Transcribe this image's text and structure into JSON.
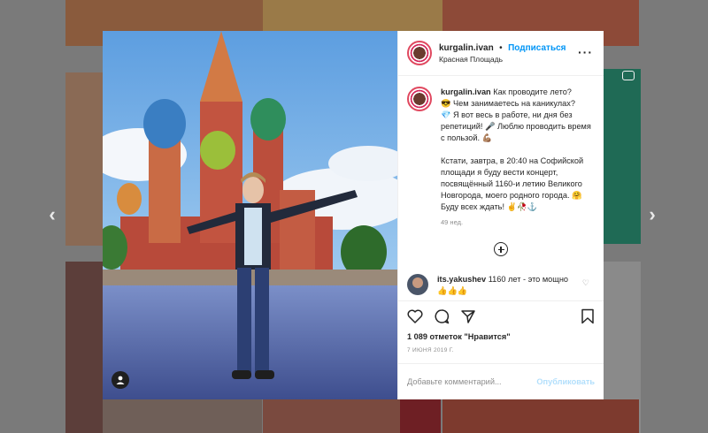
{
  "post": {
    "username": "kurgalin.ivan",
    "separator": "•",
    "follow_label": "Подписаться",
    "location": "Красная Площадь",
    "caption_user": "kurgalin.ivan",
    "caption": "Как проводите лето?\n😎 Чем занимаетесь на каникулах?\n💎 Я вот весь в работе, ни дня без репетиций! 🎤 Люблю проводить время с пользой. 💪🏽\n\nКстати, завтра, в 20:40 на Софийской площади я буду вести концерт, посвящённый 1160-и летию Великого Новгорода, моего родного города. 🤗 Буду всех ждать! ✌️🥀⚓",
    "age": "49 нед.",
    "comment": {
      "username": "its.yakushev",
      "text": "1160 лет - это мощно👍👍👍"
    },
    "likes": "1 089 отметок \"Нравится\"",
    "date": "7 ИЮНЯ 2019 Г.",
    "add_comment_placeholder": "Добавьте комментарий...",
    "publish_label": "Опубликовать"
  },
  "icons": {
    "more": "more-options-icon",
    "heart": "heart-icon",
    "comment": "comment-icon",
    "share": "share-icon",
    "bookmark": "bookmark-icon",
    "prev": "chevron-left-icon",
    "next": "chevron-right-icon",
    "tag": "user-tag-icon"
  },
  "colors": {
    "link": "#0095f6",
    "publish_disabled": "#b2dffc",
    "muted": "#8e8e8e",
    "text": "#262626"
  }
}
